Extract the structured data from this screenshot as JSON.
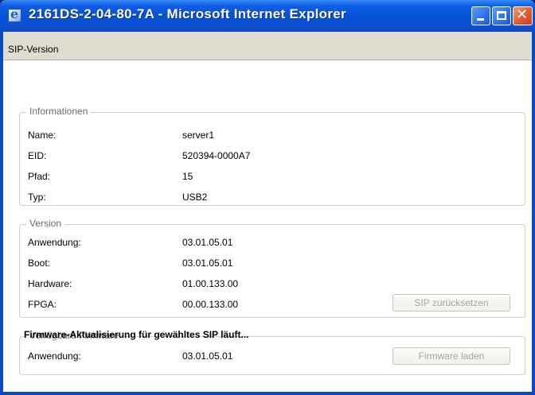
{
  "window": {
    "title": "2161DS-2-04-80-7A - Microsoft Internet Explorer",
    "app_icon": "internet-explorer-icon",
    "controls": {
      "minimize": "minimize-icon",
      "maximize": "maximize-icon",
      "close": "close-icon",
      "close_glyph": "✕"
    }
  },
  "page": {
    "header_title": "SIP-Version"
  },
  "informationen": {
    "legend": "Informationen",
    "rows": [
      {
        "label": "Name:",
        "value": "server1"
      },
      {
        "label": "EID:",
        "value": "520394-0000A7"
      },
      {
        "label": "Pfad:",
        "value": "15"
      },
      {
        "label": "Typ:",
        "value": "USB2"
      }
    ]
  },
  "version": {
    "legend": "Version",
    "rows": [
      {
        "label": "Anwendung:",
        "value": "03.01.05.01"
      },
      {
        "label": "Boot:",
        "value": "03.01.05.01"
      },
      {
        "label": "Hardware:",
        "value": "01.00.133.00"
      },
      {
        "label": "FPGA:",
        "value": "00.00.133.00"
      }
    ],
    "reset_button": "SIP zurücksetzen"
  },
  "firmware": {
    "legend": "Verfügbare Firmware",
    "rows": [
      {
        "label": "Anwendung:",
        "value": "03.01.05.01"
      }
    ],
    "load_button": "Firmware laden"
  },
  "status": {
    "text": "Firmware-Aktualisierung für gewähltes SIP läuft..."
  },
  "colors": {
    "titlebar": "#0553d8",
    "client_bg": "#ece9d8",
    "legend_text": "#6a6a6a",
    "disabled_button_text": "#a7a49a"
  }
}
